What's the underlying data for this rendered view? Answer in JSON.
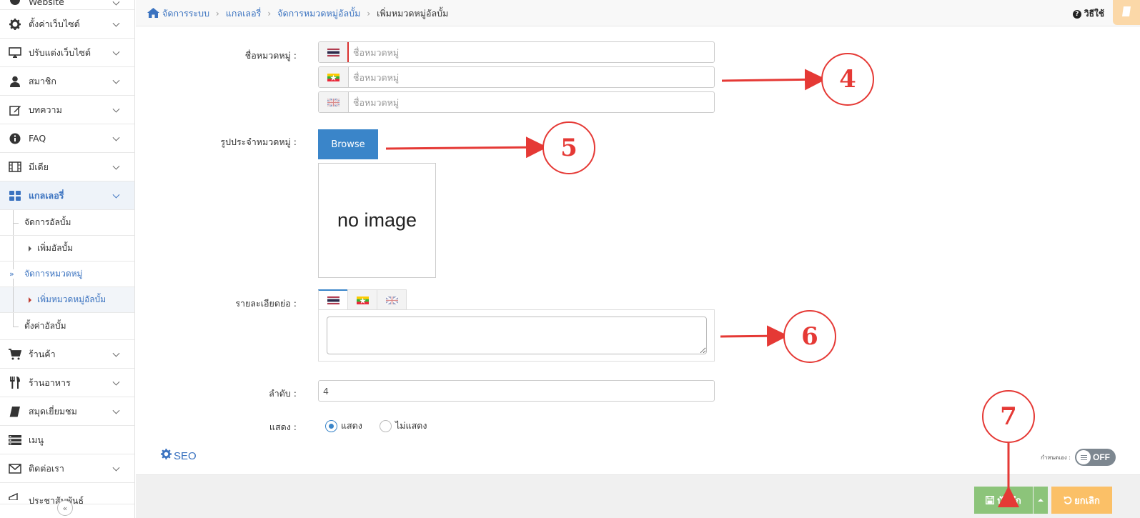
{
  "sidebar": {
    "items": [
      {
        "label": "Website",
        "icon": "globe-icon"
      },
      {
        "label": "ตั้งค่าเว็บไซต์",
        "icon": "gear-icon"
      },
      {
        "label": "ปรับแต่งเว็บไซต์",
        "icon": "monitor-icon"
      },
      {
        "label": "สมาชิก",
        "icon": "user-icon"
      },
      {
        "label": "บทความ",
        "icon": "edit-icon"
      },
      {
        "label": "FAQ",
        "icon": "info-icon"
      },
      {
        "label": "มีเดีย",
        "icon": "film-icon"
      },
      {
        "label": "แกลเลอรี่",
        "icon": "grid-icon"
      },
      {
        "label": "ร้านค้า",
        "icon": "cart-icon"
      },
      {
        "label": "ร้านอาหาร",
        "icon": "cutlery-icon"
      },
      {
        "label": "สมุดเยี่ยมชม",
        "icon": "book-icon"
      },
      {
        "label": "เมนู",
        "icon": "menu-icon"
      },
      {
        "label": "ติดต่อเรา",
        "icon": "envelope-icon"
      },
      {
        "label": "ประชาสัมพันธ์",
        "icon": "megaphone-icon"
      }
    ],
    "gallery_sub": [
      {
        "label": "จัดการอัลบั้ม"
      },
      {
        "label": "เพิ่มอัลบั้ม"
      },
      {
        "label": "จัดการหมวดหมู่"
      },
      {
        "label": "เพิ่มหมวดหมู่อัลบั้ม"
      },
      {
        "label": "ตั้งค่าอัลบั้ม"
      }
    ]
  },
  "breadcrumb": [
    "จัดการระบบ",
    "แกลเลอรี่",
    "จัดการหมวดหมู่อัลบั้ม",
    "เพิ่มหมวดหมู่อัลบั้ม"
  ],
  "help_label": "วิธีใช้",
  "form": {
    "name_label": "ชื่อหมวดหมู่ :",
    "name_placeholder": "ชื่อหมวดหมู่",
    "image_label": "รูปประจำหมวดหมู่ :",
    "browse_label": "Browse",
    "no_image": "no image",
    "detail_label": "รายละเอียดย่อ :",
    "order_label": "ลำดับ :",
    "order_value": "4",
    "show_label": "แสดง :",
    "show_options": [
      "แสดง",
      "ไม่แสดง"
    ],
    "selected_show": "แสดง"
  },
  "seo_label": "SEO",
  "custom_label": "กำหนดเอง :",
  "toggle_state": "OFF",
  "save_label": "บันทึก",
  "cancel_label": "ยกเลิก",
  "annotations": [
    "4",
    "5",
    "6",
    "7"
  ],
  "colors": {
    "primary": "#3a85c9",
    "save": "#8cc47a",
    "cancel": "#fbc067",
    "annotation": "#e53935"
  }
}
